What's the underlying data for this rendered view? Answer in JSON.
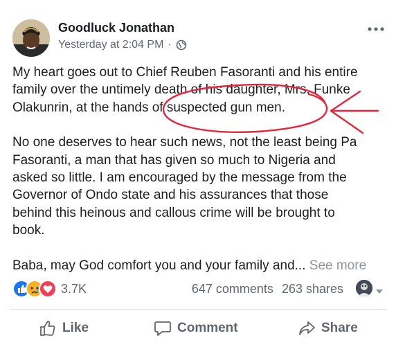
{
  "post": {
    "author": "Goodluck Jonathan",
    "timestamp": "Yesterday at 2:04 PM",
    "meta_separator": "·",
    "privacy_icon": "globe-icon",
    "paragraphs": [
      "My heart goes out to Chief Reuben Fasoranti and his entire\nfamily over the untimely death of his daughter, Mrs. Funke\nOlakunrin, at the hands of suspected gun men.",
      "No one deserves to hear such news, not the least being Pa\nFasoranti, a man that has given so much to Nigeria and\nasked so little. I am encouraged by the message from the\nGovernor of Ondo state and his assurances that those\nbehind this heinous and callous crime will be brought to\nbook."
    ],
    "truncated_text": "Baba, may God comfort you and your family and... ",
    "see_more_label": "See more",
    "annotation_color": "#e8243c"
  },
  "engagement": {
    "reactions": [
      "like-icon",
      "sad-icon",
      "love-icon"
    ],
    "reaction_count": "3.7K",
    "comments": "647 comments",
    "shares": "263 shares"
  },
  "actions": {
    "like_label": "Like",
    "comment_label": "Comment",
    "share_label": "Share"
  },
  "colors": {
    "text": "#1c1e21",
    "secondary": "#616770",
    "like_blue": "#1877f2",
    "love_red": "#f33e58",
    "sad_yellow": "#f7b125"
  }
}
